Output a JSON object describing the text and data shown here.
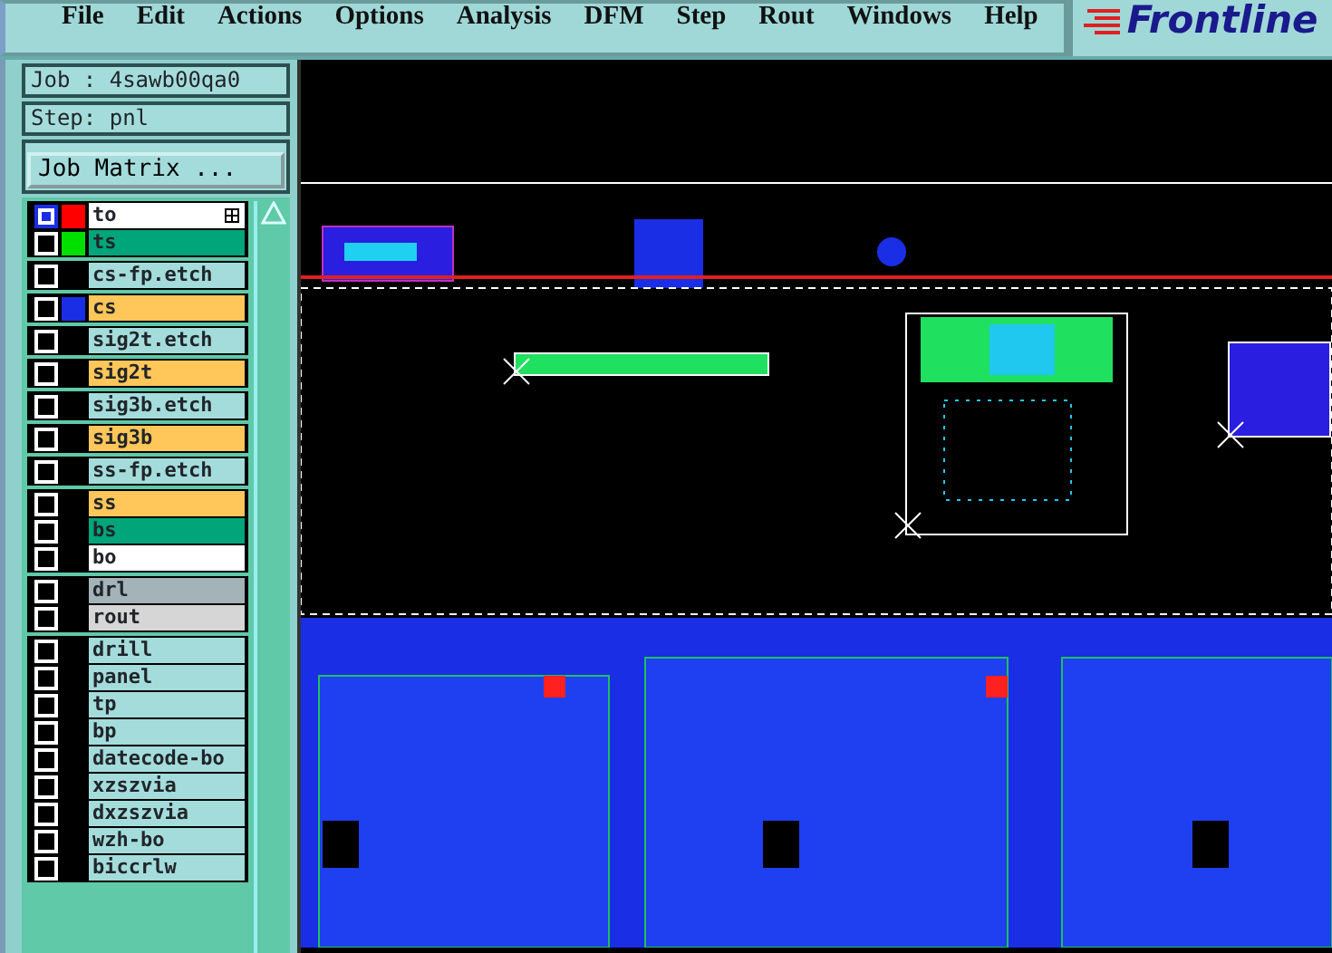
{
  "menu": [
    "File",
    "Edit",
    "Actions",
    "Options",
    "Analysis",
    "DFM",
    "Step",
    "Rout",
    "Windows",
    "Help"
  ],
  "logo": "Frontline",
  "job": "Job : 4sawb00qa0",
  "step": "Step: pnl",
  "job_matrix_button": "Job Matrix ...",
  "layer_groups": [
    {
      "layers": [
        {
          "name": "to",
          "color": "#ffffff",
          "swatch": {
            "color": "#ff0000"
          },
          "selected": true,
          "display_icon": true
        },
        {
          "name": "ts",
          "color": "#00a57a",
          "swatch": {
            "color": "#00e000"
          },
          "selected": false,
          "display_icon": false
        }
      ]
    },
    {
      "layers": [
        {
          "name": "cs-fp.etch",
          "color": "#a4dcdc",
          "selected": false,
          "display_icon": false
        }
      ]
    },
    {
      "layers": [
        {
          "name": "cs",
          "color": "#ffc65a",
          "swatch": {
            "color": "#1a2ee6"
          },
          "selected": false,
          "display_icon": false
        }
      ]
    },
    {
      "layers": [
        {
          "name": "sig2t.etch",
          "color": "#a4dcdc",
          "selected": false,
          "display_icon": false
        }
      ]
    },
    {
      "layers": [
        {
          "name": "sig2t",
          "color": "#ffc65a",
          "selected": false,
          "display_icon": false
        }
      ]
    },
    {
      "layers": [
        {
          "name": "sig3b.etch",
          "color": "#a4dcdc",
          "selected": false,
          "display_icon": false
        }
      ]
    },
    {
      "layers": [
        {
          "name": "sig3b",
          "color": "#ffc65a",
          "selected": false,
          "display_icon": false
        }
      ]
    },
    {
      "layers": [
        {
          "name": "ss-fp.etch",
          "color": "#a4dcdc",
          "selected": false,
          "display_icon": false
        }
      ]
    },
    {
      "layers": [
        {
          "name": "ss",
          "color": "#ffc65a",
          "selected": false,
          "display_icon": false
        },
        {
          "name": "bs",
          "color": "#00a57a",
          "selected": false,
          "display_icon": false
        },
        {
          "name": "bo",
          "color": "#ffffff",
          "selected": false,
          "display_icon": false
        }
      ]
    },
    {
      "layers": [
        {
          "name": "drl",
          "color": "#a3b3b8",
          "selected": false,
          "display_icon": false
        },
        {
          "name": "rout",
          "color": "#d6d6d6",
          "selected": false,
          "display_icon": false
        }
      ]
    },
    {
      "layers": [
        {
          "name": "drill",
          "color": "#a4dcdc",
          "selected": false,
          "display_icon": false
        },
        {
          "name": "panel",
          "color": "#a4dcdc",
          "selected": false,
          "display_icon": false
        },
        {
          "name": "tp",
          "color": "#a4dcdc",
          "selected": false,
          "display_icon": false
        },
        {
          "name": "bp",
          "color": "#a4dcdc",
          "selected": false,
          "display_icon": false
        },
        {
          "name": "datecode-bo",
          "color": "#a4dcdc",
          "selected": false,
          "display_icon": false
        },
        {
          "name": "xzszvia",
          "color": "#a4dcdc",
          "selected": false,
          "display_icon": false
        },
        {
          "name": "dxzszvia",
          "color": "#a4dcdc",
          "selected": false,
          "display_icon": false
        },
        {
          "name": "wzh-bo",
          "color": "#a4dcdc",
          "selected": false,
          "display_icon": false
        },
        {
          "name": "biccrlw",
          "color": "#a4dcdc",
          "selected": false,
          "display_icon": false
        }
      ]
    }
  ]
}
